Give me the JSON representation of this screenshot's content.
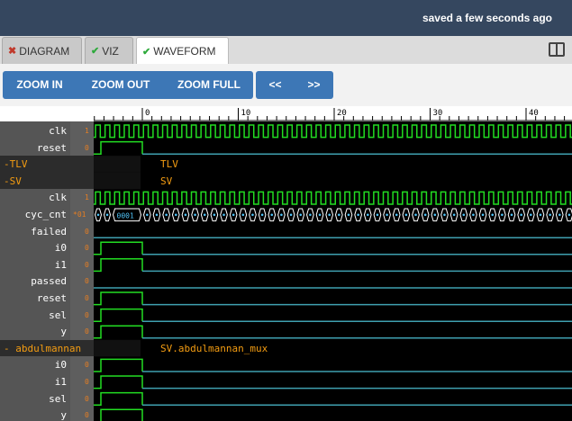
{
  "topbar": {
    "status": "saved a few seconds ago"
  },
  "tabs": [
    {
      "label": "DIAGRAM",
      "icon": "x-icon",
      "state": "error"
    },
    {
      "label": "VIZ",
      "icon": "check-icon",
      "state": "ok"
    },
    {
      "label": "WAVEFORM",
      "icon": "check-icon",
      "state": "ok",
      "active": true
    }
  ],
  "toolbar": {
    "zoom_in": "ZOOM IN",
    "zoom_out": "ZOOM OUT",
    "zoom_full": "ZOOM FULL",
    "prev": "<<",
    "next": ">>"
  },
  "timeline": {
    "ticks": [
      "0",
      "10",
      "20",
      "30",
      "40"
    ]
  },
  "rows": [
    {
      "kind": "signal",
      "name": "clk",
      "value": "1",
      "wave": "clock"
    },
    {
      "kind": "signal",
      "name": "reset",
      "value": "0",
      "wave": "rise-fall"
    },
    {
      "kind": "scope",
      "name": "TLV",
      "label": "TLV"
    },
    {
      "kind": "scope",
      "name": "SV",
      "label": "SV"
    },
    {
      "kind": "signal",
      "name": "clk",
      "value": "1",
      "wave": "clock"
    },
    {
      "kind": "signal",
      "name": "cyc_cnt",
      "value": "*01",
      "wave": "bus",
      "bus_label": "0001",
      "bus_prefix": "0"
    },
    {
      "kind": "signal",
      "name": "failed",
      "value": "0",
      "wave": "low"
    },
    {
      "kind": "signal",
      "name": "i0",
      "value": "0",
      "wave": "rise-fall"
    },
    {
      "kind": "signal",
      "name": "i1",
      "value": "0",
      "wave": "rise-fall"
    },
    {
      "kind": "signal",
      "name": "passed",
      "value": "0",
      "wave": "low"
    },
    {
      "kind": "signal",
      "name": "reset",
      "value": "0",
      "wave": "rise-fall"
    },
    {
      "kind": "signal",
      "name": "sel",
      "value": "0",
      "wave": "rise-fall"
    },
    {
      "kind": "signal",
      "name": "y",
      "value": "0",
      "wave": "rise-fall"
    },
    {
      "kind": "scope",
      "name": "abdulmannan",
      "label": "SV.abdulmannan_mux"
    },
    {
      "kind": "signal",
      "name": "i0",
      "value": "0",
      "wave": "rise-fall"
    },
    {
      "kind": "signal",
      "name": "i1",
      "value": "0",
      "wave": "rise-fall"
    },
    {
      "kind": "signal",
      "name": "sel",
      "value": "0",
      "wave": "rise-fall"
    },
    {
      "kind": "signal",
      "name": "y",
      "value": "0",
      "wave": "rise-fall"
    }
  ],
  "colors": {
    "wave_high": "#22dd22",
    "wave_low_line": "#3fa0b0",
    "bus_text": "#4fc3f7",
    "scope_text": "#f39c12",
    "value_text": "#e67e22"
  }
}
